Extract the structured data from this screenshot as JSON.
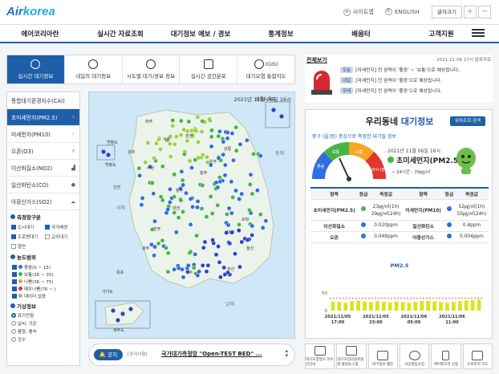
{
  "header": {
    "logo_air": "Air",
    "logo_korea": "korea",
    "sitemap": "사이트맵",
    "english": "ENGLISH",
    "font_size": "글자크기",
    "plus": "+",
    "minus": "−"
  },
  "nav": {
    "items": [
      "에어코리아란",
      "실시간 자료조회",
      "대기정보 예보 / 경보",
      "통계정보",
      "배움터",
      "고객지원"
    ]
  },
  "tabs": [
    {
      "label": "실시간 대기정보"
    },
    {
      "label": "내일의 대기정보"
    },
    {
      "label": "시도별 대기/경보 정보"
    },
    {
      "label": "실시간 공간분포"
    },
    {
      "label": "대기오염 통합지도"
    }
  ],
  "tab_gis": "(GIS)",
  "sidebar": {
    "pollutants": [
      {
        "label": "통합대기환경지수(CAI)"
      },
      {
        "label": "초미세먼지(PM2.5)"
      },
      {
        "label": "미세먼지(PM10)"
      },
      {
        "label": "오존(O3)"
      },
      {
        "label": "이산화질소(NO2)"
      },
      {
        "label": "일산화탄소(CO)"
      },
      {
        "label": "아황산가스(SO2)"
      }
    ],
    "station_title": "측정망구분",
    "stations": [
      {
        "label": "도시대기",
        "checked": true
      },
      {
        "label": "국가배경",
        "checked": true
      },
      {
        "label": "도로변대기",
        "checked": true
      },
      {
        "label": "교외대기",
        "checked": false
      },
      {
        "label": "항만",
        "checked": false
      }
    ],
    "range_title": "농도범위",
    "ranges": [
      {
        "label": "좋음(0 ~ 15)",
        "color": "#2f6ee0"
      },
      {
        "label": "보통(16 ~ 35)",
        "color": "#47b448"
      },
      {
        "label": "나쁨(36 ~ 75)",
        "color": "#f5a623"
      },
      {
        "label": "매우나쁨(76 ~ )",
        "color": "#e0372d"
      },
      {
        "label": "데이터 없음",
        "color": "#aaaaaa"
      }
    ],
    "weather_title": "기상정보",
    "weather": [
      {
        "label": "표기안함",
        "selected": true
      },
      {
        "label": "날씨, 기온",
        "selected": false
      },
      {
        "label": "풍향, 풍속",
        "selected": false
      },
      {
        "label": "강수",
        "selected": false
      }
    ]
  },
  "map": {
    "date": "2021년 11월 06일 16시",
    "regions": [
      "연평도",
      "백령도",
      "강화",
      "파주",
      "서울",
      "인천",
      "수원",
      "춘천",
      "강릉",
      "원주",
      "충주",
      "청주",
      "대전",
      "포항",
      "대구",
      "울산",
      "부산",
      "전주",
      "광주",
      "목포",
      "여수",
      "울릉도,독도",
      "가거도",
      "제주도"
    ],
    "seas": [
      "서해",
      "동해",
      "남해"
    ]
  },
  "notice": {
    "button": "공지",
    "sub": "[공지사항]",
    "text": "국가대기측정망 \"Open-TEST BED\" ..."
  },
  "alert": {
    "title": "전체보기",
    "date": "2021-11-06 17시 발표자료",
    "items": [
      {
        "badge": "오늘",
        "text": "[미세먼지] 전 권역이 '좋음' ~ '보통'으로 예상됩니다."
      },
      {
        "badge": "내일",
        "text": "[미세먼지] 전 권역이 '좋음'으로 예상됩니다."
      },
      {
        "badge": "모레",
        "text": "[미세먼지] 전 권역이 '좋음'으로 예상됩니다."
      }
    ]
  },
  "panel": {
    "title_a": "우리동네",
    "title_b": "대기정보",
    "search_btn": "위치조회 검색",
    "sub": "중구 (을)동) 중심으로 측정한 대기질 정보",
    "gauge_labels": [
      "좋음",
      "보통",
      "나쁨",
      "매우나쁨"
    ],
    "date": "2021년 11월 06일 16시",
    "pm": "초미세먼지(PM2.5)",
    "avg": "• 24시간 : 29㎍/㎥",
    "table_headers": [
      "항목",
      "등급",
      "측정값",
      "항목",
      "등급",
      "측정값"
    ],
    "rows": [
      {
        "item1": "초미세먼지(PM2.5)",
        "c1": "#47b448",
        "v1a": "23㎍/㎥(1h)",
        "v1b": "29㎍/㎥(24h)",
        "item2": "미세먼지(PM10)",
        "c2": "#2f6ee0",
        "v2a": "52㎍/㎥(1h)",
        "v2b": "55㎍/㎥(24h)"
      },
      {
        "item1": "이산화질소",
        "c1": "#2f6ee0",
        "v1a": "0.020ppm",
        "item2": "일산화탄소",
        "c2": "#2f6ee0",
        "v2a": "0.4ppm"
      },
      {
        "item1": "오존",
        "c1": "#2f6ee0",
        "v1a": "0.049ppm",
        "item2": "아황산가스",
        "c2": "#2f6ee0",
        "v2a": "0.004ppm"
      }
    ]
  },
  "chart_data": {
    "type": "bar",
    "title": "PM2.5",
    "ylim": [
      0,
      100
    ],
    "yticks": [
      50,
      0
    ],
    "xticks": [
      "2021/11/05\n17:00",
      "2021/11/05\n23:00",
      "2021/11/06\n05:00",
      "2021/11/06\n11:00"
    ],
    "threshold": 35,
    "values": [
      26,
      25,
      22,
      27,
      28,
      26,
      24,
      27,
      25,
      23,
      26,
      24,
      22,
      25,
      27,
      28,
      26,
      24,
      22,
      25,
      27,
      29,
      30,
      32
    ]
  },
  "bottom_icons": [
    {
      "label": "대기오염정보 미수신안내"
    },
    {
      "label": "대기오염의원위원회 통합뉴스룸"
    },
    {
      "label": "대기정보 웹진"
    },
    {
      "label": "국민행동요령"
    },
    {
      "label": "에어팩코리 신청"
    },
    {
      "label": "도로먼지 지도"
    }
  ]
}
